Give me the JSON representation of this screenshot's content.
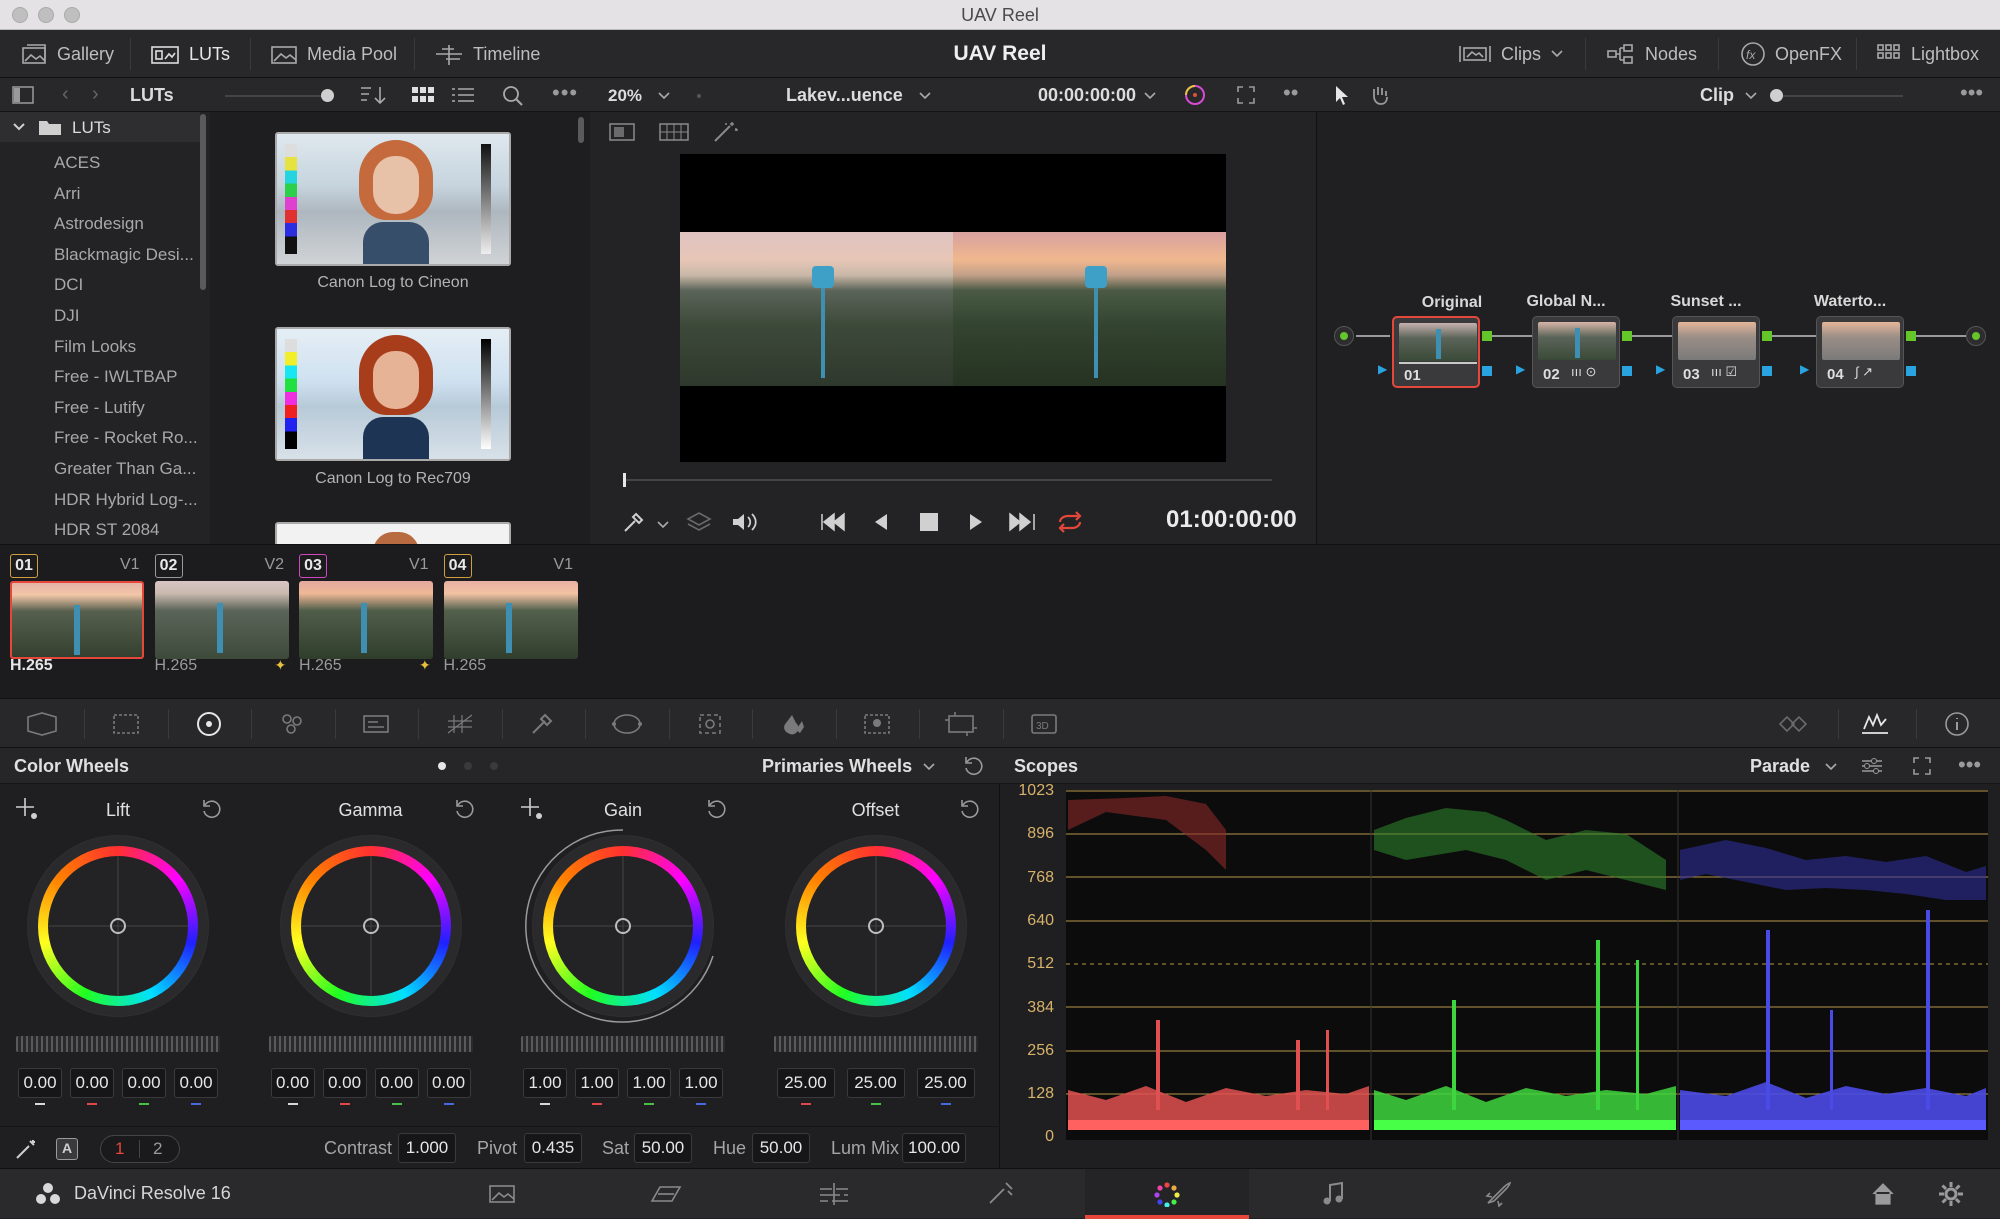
{
  "window": {
    "title": "UAV Reel"
  },
  "topbar": {
    "gallery": "Gallery",
    "luts": "LUTs",
    "media_pool": "Media Pool",
    "timeline": "Timeline",
    "project_title": "UAV Reel",
    "clips": "Clips",
    "nodes": "Nodes",
    "openfx": "OpenFX",
    "lightbox": "Lightbox"
  },
  "secbar": {
    "panel_title": "LUTs",
    "zoom": "20%",
    "timeline_name": "Lakev...uence",
    "timecode": "00:00:00:00",
    "clip_mode": "Clip"
  },
  "lut_tree": {
    "root": "LUTs",
    "items": [
      "ACES",
      "Arri",
      "Astrodesign",
      "Blackmagic Desi...",
      "DCI",
      "DJI",
      "Film Looks",
      "Free - IWLTBAP",
      "Free - Lutify",
      "Free - Rocket Ro...",
      "Greater Than Ga...",
      "HDR Hybrid Log-...",
      "HDR ST 2084"
    ]
  },
  "lut_browser": {
    "items": [
      "Canon Log to Cineon",
      "Canon Log to Rec709"
    ]
  },
  "viewer": {
    "timecode": "01:00:00:00"
  },
  "clips": [
    {
      "num": "01",
      "track": "V1",
      "codec": "H.265"
    },
    {
      "num": "02",
      "track": "V2",
      "codec": "H.265"
    },
    {
      "num": "03",
      "track": "V1",
      "codec": "H.265"
    },
    {
      "num": "04",
      "track": "V1",
      "codec": "H.265"
    }
  ],
  "nodes": [
    {
      "title": "Original",
      "num": "01"
    },
    {
      "title": "Global N...",
      "num": "02"
    },
    {
      "title": "Sunset ...",
      "num": "03"
    },
    {
      "title": "Waterto...",
      "num": "04"
    }
  ],
  "color_wheels": {
    "title": "Color Wheels",
    "mode": "Primaries Wheels",
    "wheels": [
      {
        "name": "Lift",
        "values": [
          "0.00",
          "0.00",
          "0.00",
          "0.00"
        ]
      },
      {
        "name": "Gamma",
        "values": [
          "0.00",
          "0.00",
          "0.00",
          "0.00"
        ]
      },
      {
        "name": "Gain",
        "values": [
          "1.00",
          "1.00",
          "1.00",
          "1.00"
        ]
      },
      {
        "name": "Offset",
        "values": [
          "25.00",
          "25.00",
          "25.00"
        ]
      }
    ],
    "footer": {
      "page1": "1",
      "page2": "2",
      "contrast_label": "Contrast",
      "contrast": "1.000",
      "pivot_label": "Pivot",
      "pivot": "0.435",
      "sat_label": "Sat",
      "sat": "50.00",
      "hue_label": "Hue",
      "hue": "50.00",
      "lummix_label": "Lum Mix",
      "lummix": "100.00"
    }
  },
  "scopes": {
    "title": "Scopes",
    "mode": "Parade",
    "ticks": [
      "1023",
      "896",
      "768",
      "640",
      "512",
      "384",
      "256",
      "128",
      "0"
    ]
  },
  "bottom": {
    "app_name": "DaVinci Resolve 16"
  },
  "colors": {
    "accent_red": "#e5473a",
    "accent_yellow": "#d0a040",
    "node_green": "#65c62c",
    "node_blue": "#2aa4e0"
  }
}
